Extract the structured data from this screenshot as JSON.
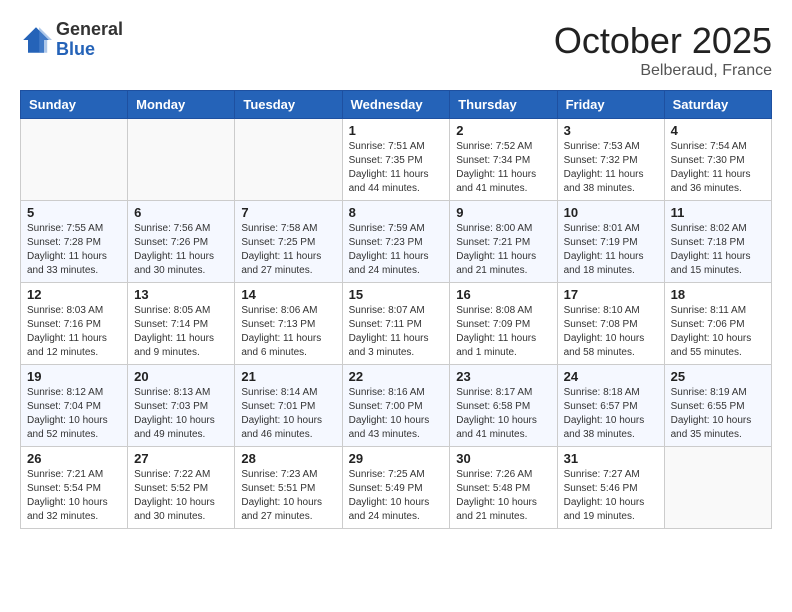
{
  "header": {
    "logo_general": "General",
    "logo_blue": "Blue",
    "month_title": "October 2025",
    "location": "Belberaud, France"
  },
  "weekdays": [
    "Sunday",
    "Monday",
    "Tuesday",
    "Wednesday",
    "Thursday",
    "Friday",
    "Saturday"
  ],
  "weeks": [
    [
      {
        "day": "",
        "info": ""
      },
      {
        "day": "",
        "info": ""
      },
      {
        "day": "",
        "info": ""
      },
      {
        "day": "1",
        "info": "Sunrise: 7:51 AM\nSunset: 7:35 PM\nDaylight: 11 hours and 44 minutes."
      },
      {
        "day": "2",
        "info": "Sunrise: 7:52 AM\nSunset: 7:34 PM\nDaylight: 11 hours and 41 minutes."
      },
      {
        "day": "3",
        "info": "Sunrise: 7:53 AM\nSunset: 7:32 PM\nDaylight: 11 hours and 38 minutes."
      },
      {
        "day": "4",
        "info": "Sunrise: 7:54 AM\nSunset: 7:30 PM\nDaylight: 11 hours and 36 minutes."
      }
    ],
    [
      {
        "day": "5",
        "info": "Sunrise: 7:55 AM\nSunset: 7:28 PM\nDaylight: 11 hours and 33 minutes."
      },
      {
        "day": "6",
        "info": "Sunrise: 7:56 AM\nSunset: 7:26 PM\nDaylight: 11 hours and 30 minutes."
      },
      {
        "day": "7",
        "info": "Sunrise: 7:58 AM\nSunset: 7:25 PM\nDaylight: 11 hours and 27 minutes."
      },
      {
        "day": "8",
        "info": "Sunrise: 7:59 AM\nSunset: 7:23 PM\nDaylight: 11 hours and 24 minutes."
      },
      {
        "day": "9",
        "info": "Sunrise: 8:00 AM\nSunset: 7:21 PM\nDaylight: 11 hours and 21 minutes."
      },
      {
        "day": "10",
        "info": "Sunrise: 8:01 AM\nSunset: 7:19 PM\nDaylight: 11 hours and 18 minutes."
      },
      {
        "day": "11",
        "info": "Sunrise: 8:02 AM\nSunset: 7:18 PM\nDaylight: 11 hours and 15 minutes."
      }
    ],
    [
      {
        "day": "12",
        "info": "Sunrise: 8:03 AM\nSunset: 7:16 PM\nDaylight: 11 hours and 12 minutes."
      },
      {
        "day": "13",
        "info": "Sunrise: 8:05 AM\nSunset: 7:14 PM\nDaylight: 11 hours and 9 minutes."
      },
      {
        "day": "14",
        "info": "Sunrise: 8:06 AM\nSunset: 7:13 PM\nDaylight: 11 hours and 6 minutes."
      },
      {
        "day": "15",
        "info": "Sunrise: 8:07 AM\nSunset: 7:11 PM\nDaylight: 11 hours and 3 minutes."
      },
      {
        "day": "16",
        "info": "Sunrise: 8:08 AM\nSunset: 7:09 PM\nDaylight: 11 hours and 1 minute."
      },
      {
        "day": "17",
        "info": "Sunrise: 8:10 AM\nSunset: 7:08 PM\nDaylight: 10 hours and 58 minutes."
      },
      {
        "day": "18",
        "info": "Sunrise: 8:11 AM\nSunset: 7:06 PM\nDaylight: 10 hours and 55 minutes."
      }
    ],
    [
      {
        "day": "19",
        "info": "Sunrise: 8:12 AM\nSunset: 7:04 PM\nDaylight: 10 hours and 52 minutes."
      },
      {
        "day": "20",
        "info": "Sunrise: 8:13 AM\nSunset: 7:03 PM\nDaylight: 10 hours and 49 minutes."
      },
      {
        "day": "21",
        "info": "Sunrise: 8:14 AM\nSunset: 7:01 PM\nDaylight: 10 hours and 46 minutes."
      },
      {
        "day": "22",
        "info": "Sunrise: 8:16 AM\nSunset: 7:00 PM\nDaylight: 10 hours and 43 minutes."
      },
      {
        "day": "23",
        "info": "Sunrise: 8:17 AM\nSunset: 6:58 PM\nDaylight: 10 hours and 41 minutes."
      },
      {
        "day": "24",
        "info": "Sunrise: 8:18 AM\nSunset: 6:57 PM\nDaylight: 10 hours and 38 minutes."
      },
      {
        "day": "25",
        "info": "Sunrise: 8:19 AM\nSunset: 6:55 PM\nDaylight: 10 hours and 35 minutes."
      }
    ],
    [
      {
        "day": "26",
        "info": "Sunrise: 7:21 AM\nSunset: 5:54 PM\nDaylight: 10 hours and 32 minutes."
      },
      {
        "day": "27",
        "info": "Sunrise: 7:22 AM\nSunset: 5:52 PM\nDaylight: 10 hours and 30 minutes."
      },
      {
        "day": "28",
        "info": "Sunrise: 7:23 AM\nSunset: 5:51 PM\nDaylight: 10 hours and 27 minutes."
      },
      {
        "day": "29",
        "info": "Sunrise: 7:25 AM\nSunset: 5:49 PM\nDaylight: 10 hours and 24 minutes."
      },
      {
        "day": "30",
        "info": "Sunrise: 7:26 AM\nSunset: 5:48 PM\nDaylight: 10 hours and 21 minutes."
      },
      {
        "day": "31",
        "info": "Sunrise: 7:27 AM\nSunset: 5:46 PM\nDaylight: 10 hours and 19 minutes."
      },
      {
        "day": "",
        "info": ""
      }
    ]
  ]
}
